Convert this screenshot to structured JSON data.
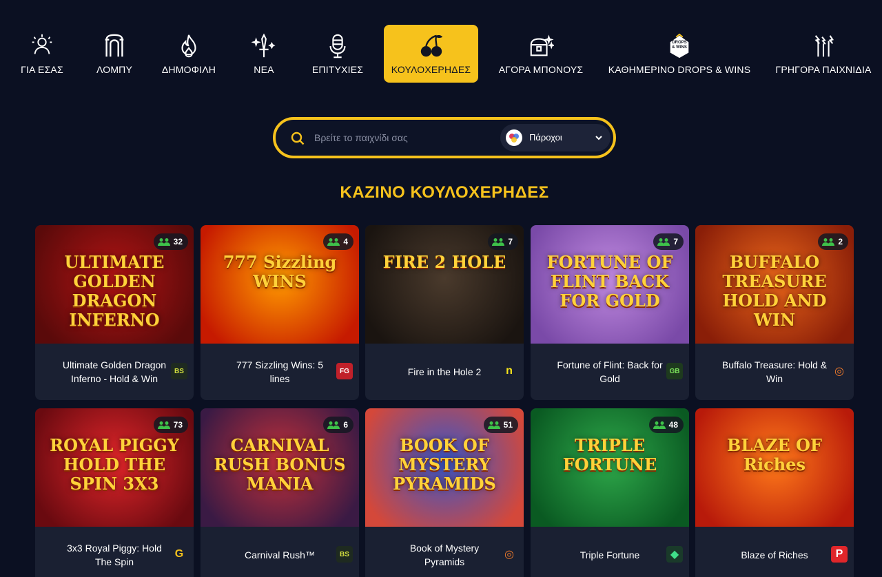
{
  "colors": {
    "accent": "#f6c21c",
    "background": "#0b1022",
    "card": "#1a2032"
  },
  "nav": {
    "items": [
      {
        "label": "ΓΙΑ ΕΣΑΣ",
        "icon": "user-star-icon",
        "active": false
      },
      {
        "label": "ΛΟΜΠΥ",
        "icon": "arch-icon",
        "active": false
      },
      {
        "label": "ΔΗΜΟΦΙΛΗ",
        "icon": "flame-icon",
        "active": false
      },
      {
        "label": "ΝΕΑ",
        "icon": "sparkle-sword-icon",
        "active": false
      },
      {
        "label": "ΕΠΙΤΥΧΙΕΣ",
        "icon": "microphone-icon",
        "active": false
      },
      {
        "label": "ΚΟΥΛΟΧΕΡΗΔΕΣ",
        "icon": "cherries-icon",
        "active": true
      },
      {
        "label": "ΑΓΟΡΑ ΜΠΟΝΟΥΣ",
        "icon": "treasure-chest-icon",
        "active": false
      },
      {
        "label": "ΚΑΘΗΜΕΡΙΝΟ DROPS & WINS",
        "icon": "drops-wins-icon",
        "icon_text": "DROPS & WINS",
        "active": false
      },
      {
        "label": "ΓΡΗΓΟΡΑ ΠΑΙΧΝΙΔΙΑ",
        "icon": "lightning-icon",
        "active": false
      }
    ]
  },
  "search": {
    "placeholder": "Βρείτε το παιχνίδι σας",
    "providers_label": "Πάροχοι"
  },
  "section": {
    "title": "ΚΑΖΙΝΟ ΚΟΥΛΟΧΕΡΗΔΕΣ"
  },
  "games": [
    {
      "name": "Ultimate Golden Dragon Inferno - Hold & Win",
      "players": "32",
      "thumb_text": "ULTIMATE GOLDEN DRAGON INFERNO",
      "provider": "bs-logo",
      "theme": [
        "#b11414",
        "#5a0a0a"
      ]
    },
    {
      "name": "777 Sizzling Wins: 5 lines",
      "players": "4",
      "thumb_text": "777 Sizzling WINS",
      "provider": "fg-logo",
      "theme": [
        "#ff9a00",
        "#c61a00"
      ]
    },
    {
      "name": "Fire in the Hole 2",
      "players": "7",
      "thumb_text": "FIRE 2 HOLE",
      "provider": "n-logo",
      "theme": [
        "#4a3a2c",
        "#1a1410"
      ]
    },
    {
      "name": "Fortune of Flint: Back for Gold",
      "players": "7",
      "thumb_text": "FORTUNE OF FLINT BACK FOR GOLD",
      "provider": "game-beat-logo",
      "theme": [
        "#c08ae0",
        "#7a4aa8"
      ]
    },
    {
      "name": "Buffalo Treasure: Hold & Win",
      "players": "2",
      "thumb_text": "BUFFALO TREASURE HOLD AND WIN",
      "provider": "target-logo",
      "theme": [
        "#e8651a",
        "#8a1e08"
      ]
    },
    {
      "name": "3x3 Royal Piggy: Hold The Spin",
      "players": "73",
      "thumb_text": "ROYAL PIGGY HOLD THE SPIN 3X3",
      "provider": "g-logo",
      "theme": [
        "#e0262a",
        "#6a0a10"
      ]
    },
    {
      "name": "Carnival Rush™",
      "players": "6",
      "thumb_text": "CARNIVAL RUSH BONUS MANIA",
      "provider": "bs-logo",
      "theme": [
        "#c2303a",
        "#3a1a44"
      ]
    },
    {
      "name": "Book of Mystery Pyramids",
      "players": "51",
      "thumb_text": "BOOK OF MYSTERY PYRAMIDS",
      "provider": "target-logo",
      "theme": [
        "#3a56c8",
        "#d4483a"
      ]
    },
    {
      "name": "Triple Fortune",
      "players": "48",
      "thumb_text": "TRIPLE FORTUNE",
      "provider": "diamond-logo",
      "theme": [
        "#2ea84a",
        "#0a5a22"
      ]
    },
    {
      "name": "Blaze of Riches",
      "players": "",
      "thumb_text": "BLAZE OF Riches",
      "provider": "p-logo",
      "theme": [
        "#ff7a1a",
        "#b81a0a"
      ]
    }
  ]
}
